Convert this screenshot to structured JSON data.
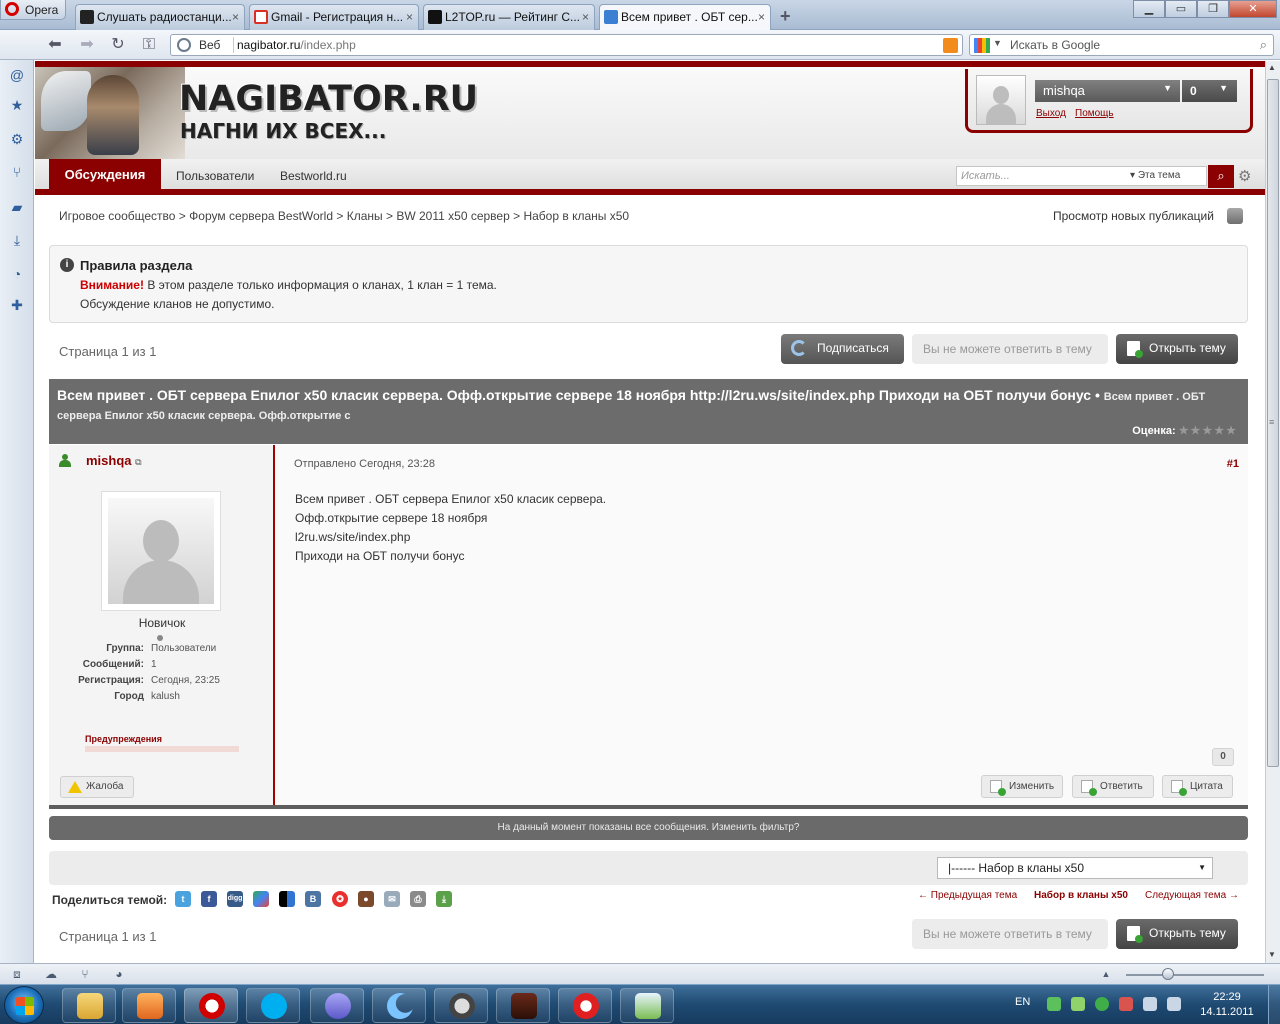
{
  "browser": {
    "menu_label": "Opera",
    "tabs": [
      {
        "label": "Слушать радиостанци..."
      },
      {
        "label": "Gmail - Регистрация н..."
      },
      {
        "label": "L2TOP.ru — Рейтинг С..."
      },
      {
        "label": "Всем привет . ОБТ сер..."
      }
    ],
    "address_label": "Веб",
    "url_domain": "nagibator.ru",
    "url_path": "/index.php",
    "search_placeholder": "Искать в Google"
  },
  "site": {
    "logo_title": "NAGIBATOR.RU",
    "logo_subtitle": "НАГНИ ИХ ВСЕХ...",
    "user": {
      "name": "mishqa",
      "notifications": "0",
      "logout": "Выход",
      "help": "Помощь"
    },
    "nav": [
      {
        "label": "Обсуждения",
        "active": true
      },
      {
        "label": "Пользователи",
        "active": false
      },
      {
        "label": "Bestworld.ru",
        "active": false
      }
    ],
    "search": {
      "placeholder": "Искать...",
      "scope": "Эта тема"
    }
  },
  "breadcrumb": {
    "items": [
      "Игровое сообщество",
      "Форум сервера BestWorld",
      "Кланы",
      "BW 2011 x50 сервер",
      "Набор в кланы x50"
    ],
    "separator": ">",
    "new_posts": "Просмотр новых публикаций"
  },
  "rules": {
    "title": "Правила раздела",
    "warning": "Внимание!",
    "line1": " В этом разделе только информация о кланах, 1 клан = 1 тема.",
    "line2": "Обсуждение кланов не допустимо."
  },
  "pagination": {
    "label": "Страница 1 из 1"
  },
  "buttons": {
    "subscribe": "Подписаться",
    "no_reply": "Вы не можете ответить в тему",
    "open_topic": "Открыть тему"
  },
  "topic": {
    "title": "Всем привет . ОБТ сервера Епилог x50 класик сервера. Офф.открытие сервере 18 ноября http://l2ru.ws/site/index.php Приходи на ОБТ получи бонус",
    "bullet": " • ",
    "subtitle": "Всем привет . ОБТ сервера Епилог x50 класик сервера. Офф.открытие с",
    "rating_label": "Оценка:",
    "rating_stars": "★★★★★"
  },
  "post": {
    "author": "mishqa",
    "rank": "Новичок",
    "fields": [
      {
        "k": "Группа:",
        "v": "Пользователи"
      },
      {
        "k": "Сообщений:",
        "v": "1"
      },
      {
        "k": "Регистрация:",
        "v": "Сегодня, 23:25"
      },
      {
        "k": "Город",
        "v": "kalush"
      }
    ],
    "warnings_label": "Предупреждения",
    "report": "Жалоба",
    "date": "Отправлено Сегодня, 23:28",
    "number": "#1",
    "body": [
      "Всем привет . ОБТ сервера Епилог x50 класик сервера.",
      "Офф.открытие сервере 18 ноября",
      "l2ru.ws/site/index.php",
      "Приходи на ОБТ получи бонус"
    ],
    "reputation": "0",
    "edit": "Изменить",
    "reply": "Ответить",
    "quote": "Цитата"
  },
  "filter_notice": "На данный момент показаны все сообщения. Изменить фильтр?",
  "jump_select": "|------ Набор в кланы x50",
  "share": {
    "label": "Поделиться темой:"
  },
  "topic_nav": {
    "prev": "← Предыдущая тема",
    "current": "Набор в кланы x50",
    "next": "Следующая тема →"
  },
  "taskbar": {
    "lang": "EN",
    "time": "22:29",
    "date": "14.11.2011"
  }
}
